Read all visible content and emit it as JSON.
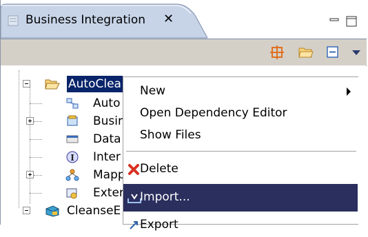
{
  "view": {
    "tab_title": "Business Integration",
    "close_glyph": "✕"
  },
  "toolbar": {
    "icons": [
      "grid-icon",
      "open-folder-icon",
      "collapse-all-icon",
      "view-menu-icon"
    ]
  },
  "tree": {
    "root_label": "AutoClea",
    "children": [
      {
        "label": "Auto",
        "icon": "dependency-icon"
      },
      {
        "label": "Busin",
        "icon": "business-objects-icon"
      },
      {
        "label": "Data",
        "icon": "data-types-icon"
      },
      {
        "label": "Inter",
        "icon": "interfaces-icon"
      },
      {
        "label": "Mapp",
        "icon": "mappings-icon"
      },
      {
        "label": "Exter",
        "icon": "external-icon"
      }
    ],
    "next_root_label": "CleanseE"
  },
  "context_menu": {
    "items": [
      {
        "label": "New",
        "has_submenu": true
      },
      {
        "label": "Open Dependency Editor"
      },
      {
        "label": "Show Files"
      },
      {
        "label": "Delete",
        "icon": "delete-icon"
      },
      {
        "label": "Import...",
        "icon": "import-icon",
        "highlighted": true
      },
      {
        "label": "Export",
        "icon": "export-icon"
      }
    ]
  },
  "colors": {
    "selection": "#0a246a",
    "menu_highlight": "#2b2f5e",
    "toolbar_bg": "#d4d0c8",
    "accent_orange": "#e07020"
  }
}
